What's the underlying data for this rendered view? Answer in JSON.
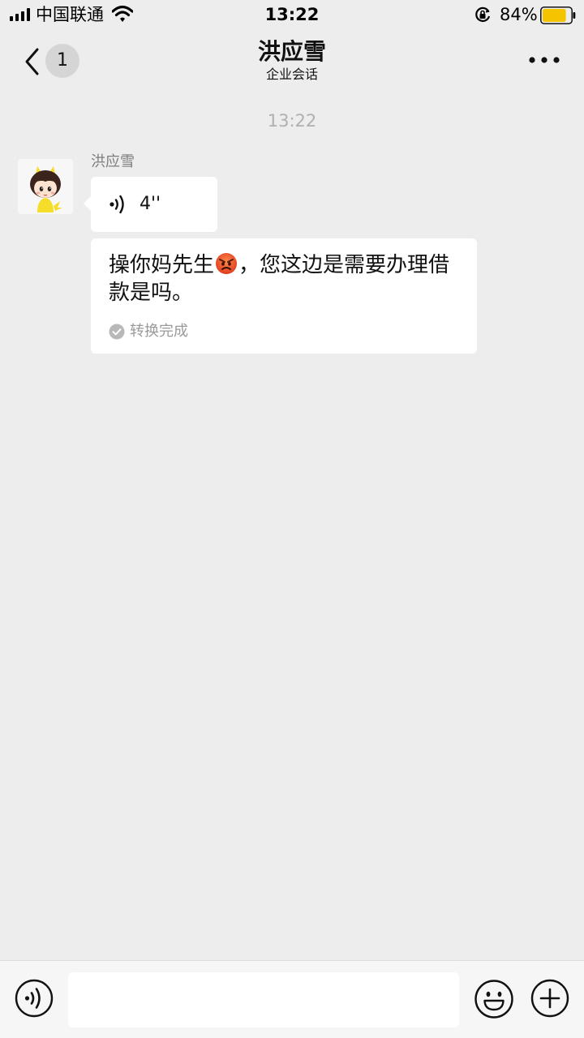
{
  "status_bar": {
    "carrier": "中国联通",
    "time": "13:22",
    "battery_percent": "84%",
    "battery_level": 0.84,
    "icons": [
      "signal-icon",
      "wifi-icon",
      "rotation-lock-icon",
      "battery-icon"
    ]
  },
  "nav": {
    "unread_count": "1",
    "title": "洪应雪",
    "subtitle": "企业会话",
    "icons": [
      "back-chevron-icon",
      "more-icon"
    ]
  },
  "chat": {
    "timestamp": "13:22",
    "sender_name": "洪应雪",
    "voice_duration": "4''",
    "transcript_part1": "操你妈先生",
    "transcript_part2": "，您这边是需要办理借款是吗。",
    "transcript_status": "转换完成",
    "icons": [
      "avatar",
      "voice-wave-icon",
      "angry-emoji-icon",
      "check-circle-icon"
    ]
  },
  "input_bar": {
    "text_value": "",
    "icons": [
      "voice-mode-icon",
      "emoji-icon",
      "plus-icon"
    ]
  },
  "colors": {
    "background": "#ededed",
    "bubble": "#ffffff",
    "battery_fill": "#f5c400",
    "muted_text": "#9a9a9a"
  }
}
